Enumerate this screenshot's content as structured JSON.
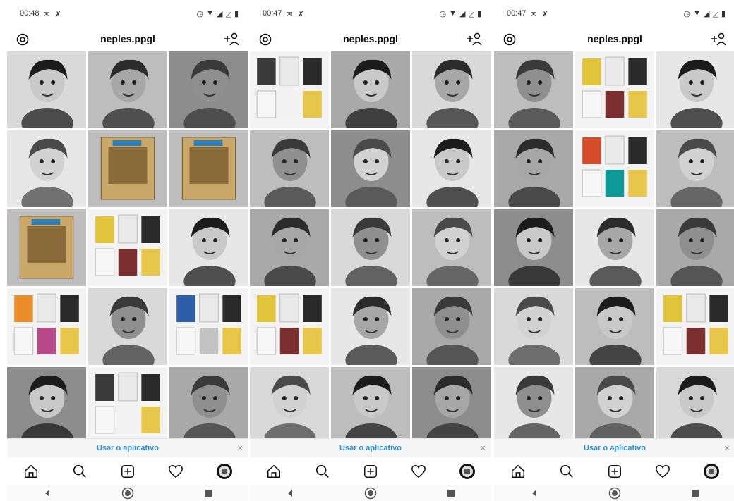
{
  "screens": [
    {
      "status": {
        "time": "00:48"
      },
      "header": {
        "username": "neples.ppgl"
      },
      "banner": {
        "text": "Usar o aplicativo",
        "close": "×"
      },
      "tiles": [
        "portrait-smiling-woman-short-hair",
        "portrait-man-curly-glasses",
        "portrait-woman-hand-chin",
        "portrait-young-man-glasses",
        "magazine-issue",
        "magazine-issue",
        "magazine-issue",
        "book-stack",
        "portrait-woman-smiling",
        "books-on-table",
        "portrait-man-glasses-beard",
        "books-colorful",
        "portrait-older-woman-glasses",
        "books-colorful",
        "portrait-man-glasses"
      ]
    },
    {
      "status": {
        "time": "00:47"
      },
      "header": {
        "username": "neples.ppgl"
      },
      "banner": {
        "text": "Usar o aplicativo",
        "close": "×"
      },
      "tiles": [
        "book-orange",
        "portrait-older-man-cap",
        "portrait-older-woman-glasses",
        "portrait-bearded-man-glasses",
        "portrait-smiling-woman",
        "portrait-young-man-glasses",
        "portrait-woman-curly",
        "portrait-man",
        "portrait-blonde-woman",
        "books-on-table",
        "portrait-man-sunglasses-beard",
        "portrait-smiling-woman",
        "portrait-bald-man-smiling",
        "portrait-curly-woman-glasses",
        "portrait-older-man"
      ]
    },
    {
      "status": {
        "time": "00:47"
      },
      "header": {
        "username": "neples.ppgl"
      },
      "banner": {
        "text": "Usar o aplicativo",
        "close": "×"
      },
      "tiles": [
        "portrait-curly-woman-glasses",
        "books-on-table",
        "portrait-older-man-glasses",
        "portrait-woman-smiling",
        "books-colorful",
        "portrait-curly-man",
        "portrait-woman-dark-curly",
        "portrait-young-man-glasses",
        "portrait-woman-short-hair",
        "portrait-older-man",
        "portrait-woman-curly-smiling",
        "books-on-table",
        "portrait-older-man-glasses",
        "portrait-woman-laughing",
        "portrait-woman-thinking"
      ]
    }
  ]
}
